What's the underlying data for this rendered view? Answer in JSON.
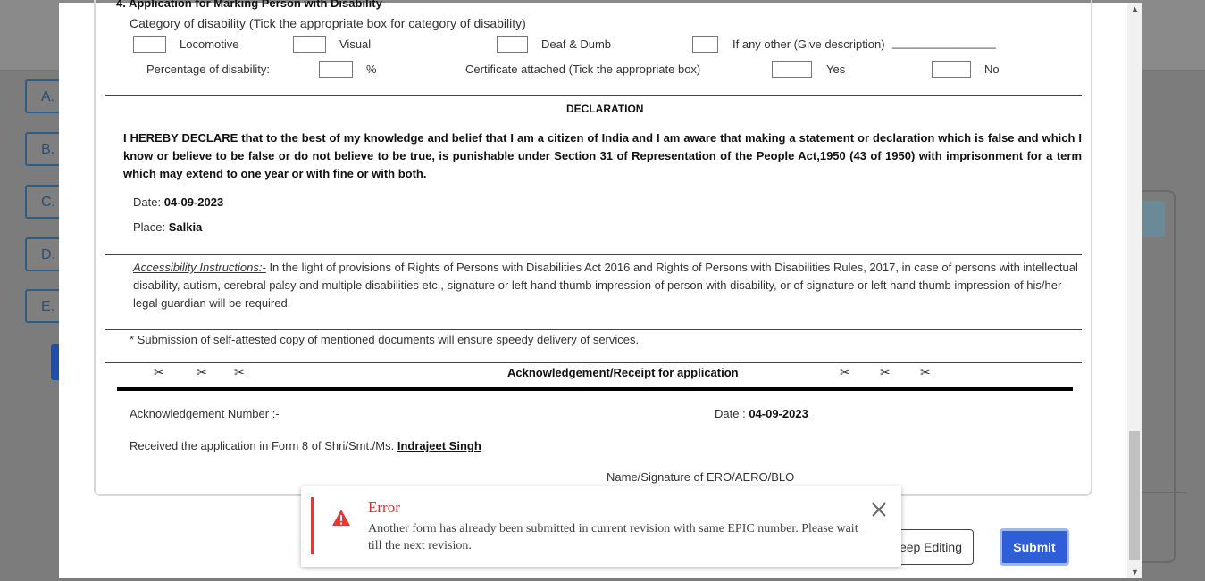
{
  "background": {
    "options": [
      "A.",
      "B.",
      "C.",
      "D.",
      "E."
    ]
  },
  "form": {
    "section_heading": "4. Application for Marking Person with Disability",
    "category_label": "Category of disability (Tick the appropriate box for category of disability)",
    "locomotive": "Locomotive",
    "visual": "Visual",
    "deaf_dumb": "Deaf & Dumb",
    "other": "If any other (Give description)",
    "other_blank": "________________",
    "percentage_label": "Percentage of disability:",
    "percent_sign": "%",
    "certificate_label": "Certificate attached (Tick the appropriate box)",
    "yes": "Yes",
    "no": "No",
    "declaration_heading": "DECLARATION",
    "declaration_text": "I HEREBY DECLARE that to the best of my knowledge and belief that I am a citizen of India and I am aware that making a statement or declaration which is false and which I know or believe to be false or do not believe to be true, is punishable under Section 31 of Representation of the People Act,1950 (43 of 1950) with imprisonment for a term which may extend to one year or with fine or with both.",
    "date_label": "Date:",
    "date_value": "04-09-2023",
    "place_label": "Place:",
    "place_value": "Salkia",
    "access_title": "Accessibility Instructions:-",
    "access_text": " In the light of provisions of Rights of Persons with Disabilities Act 2016 and Rights of Persons with Disabilities Rules, 2017, in case of persons with intellectual disability, autism, cerebral palsy and multiple disabilities etc., signature or left hand thumb impression of person with disability, or of signature or left hand thumb impression of his/her legal guardian will be required.",
    "submission_note": "* Submission of self-attested copy of mentioned documents will ensure speedy delivery of services.",
    "scissor": "✂",
    "ack_heading": "Acknowledgement/Receipt for application",
    "ack_number_label": "Acknowledgement Number :-",
    "ack_date_label": "Date :",
    "ack_date_value": "04-09-2023",
    "received_label": "Received the application in Form 8 of  Shri/Smt./Ms.",
    "received_name": "Indrajeet  Singh",
    "signature_label": "Name/Signature of ERO/AERO/BLO"
  },
  "buttons": {
    "keep_editing": "eep Editing",
    "submit": "Submit"
  },
  "toast": {
    "title": "Error",
    "message": "Another form has already been submitted in current revision with same EPIC number. Please wait till the next revision."
  },
  "scrollbar": {
    "up": "▲",
    "down": "▼"
  },
  "colors": {
    "error": "#e53935",
    "submit": "#2f5fd8"
  }
}
